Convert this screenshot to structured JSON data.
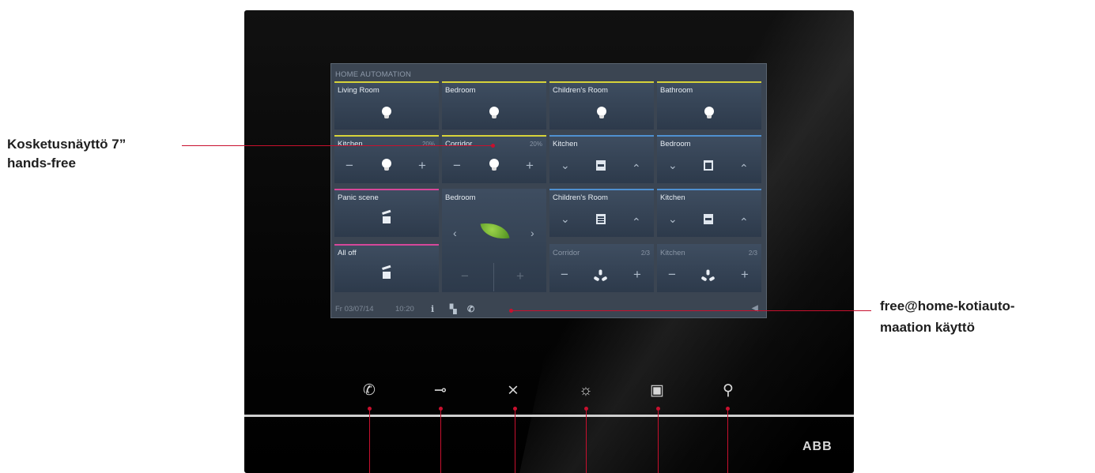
{
  "annotations": {
    "left_line1": "Kosketusnäyttö 7”",
    "left_line2": "hands-free",
    "right_line1": "free@home-kotiauto-",
    "right_line2": "maation käyttö"
  },
  "screen": {
    "title": "HOME AUTOMATION",
    "tiles": {
      "living_room": {
        "label": "Living Room"
      },
      "bedroom_light": {
        "label": "Bedroom"
      },
      "childrens_room_light": {
        "label": "Children's Room"
      },
      "bathroom": {
        "label": "Bathroom"
      },
      "kitchen_dimmer": {
        "label": "Kitchen",
        "percent": "20%"
      },
      "corridor_dimmer": {
        "label": "Corridor",
        "percent": "20%"
      },
      "kitchen_blind": {
        "label": "Kitchen"
      },
      "bedroom_blind": {
        "label": "Bedroom"
      },
      "panic_scene": {
        "label": "Panic scene"
      },
      "bedroom_climate": {
        "label": "Bedroom"
      },
      "childrens_room_blind": {
        "label": "Children's Room"
      },
      "kitchen_blind_2": {
        "label": "Kitchen"
      },
      "all_off": {
        "label": "All off"
      },
      "corridor_fan": {
        "label": "Corridor",
        "level": "2/3"
      },
      "kitchen_fan": {
        "label": "Kitchen",
        "level": "2/3"
      }
    },
    "status": {
      "date": "Fr 03/07/14",
      "time": "10:20"
    }
  },
  "device": {
    "brand": "ABB"
  },
  "icons": [
    "light-bulb-icon",
    "minus-icon",
    "plus-icon",
    "chevron-down-icon",
    "chevron-up-icon",
    "blind-icon",
    "scene-icon",
    "leaf-icon",
    "chevron-left-icon",
    "chevron-right-icon",
    "fan-icon",
    "info-icon",
    "door-icon",
    "phone-icon",
    "speaker-icon",
    "key-icon",
    "mute-icon",
    "light-icon",
    "camera-icon",
    "wrench-icon"
  ],
  "colors": {
    "light_group": "#d7d33a",
    "blind_group": "#4f90d0",
    "scene_group": "#d6479a",
    "pointer": "#c8102e"
  }
}
